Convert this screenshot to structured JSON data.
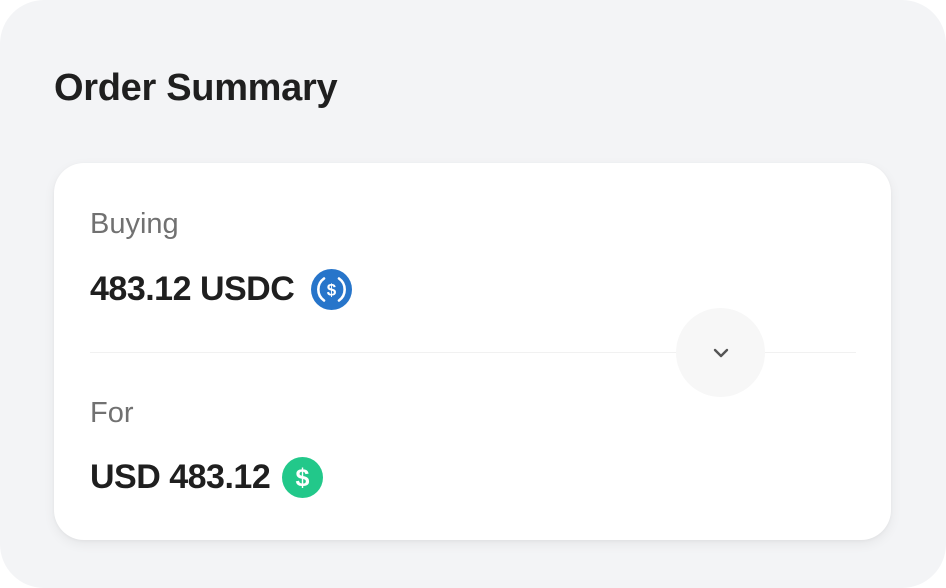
{
  "order_summary": {
    "title": "Order Summary",
    "buying": {
      "label": "Buying",
      "amount": "483.12 USDC",
      "icon": "usdc-coin-icon"
    },
    "for": {
      "label": "For",
      "amount": "USD 483.12",
      "icon": "usd-coin-icon"
    },
    "swap_icon": "chevron-down-icon"
  },
  "colors": {
    "panel_background": "#f3f4f6",
    "card_background": "#ffffff",
    "usdc_blue": "#2775ca",
    "usd_green": "#22c88a",
    "text_primary": "#1f1f1f",
    "text_secondary": "#717171"
  }
}
